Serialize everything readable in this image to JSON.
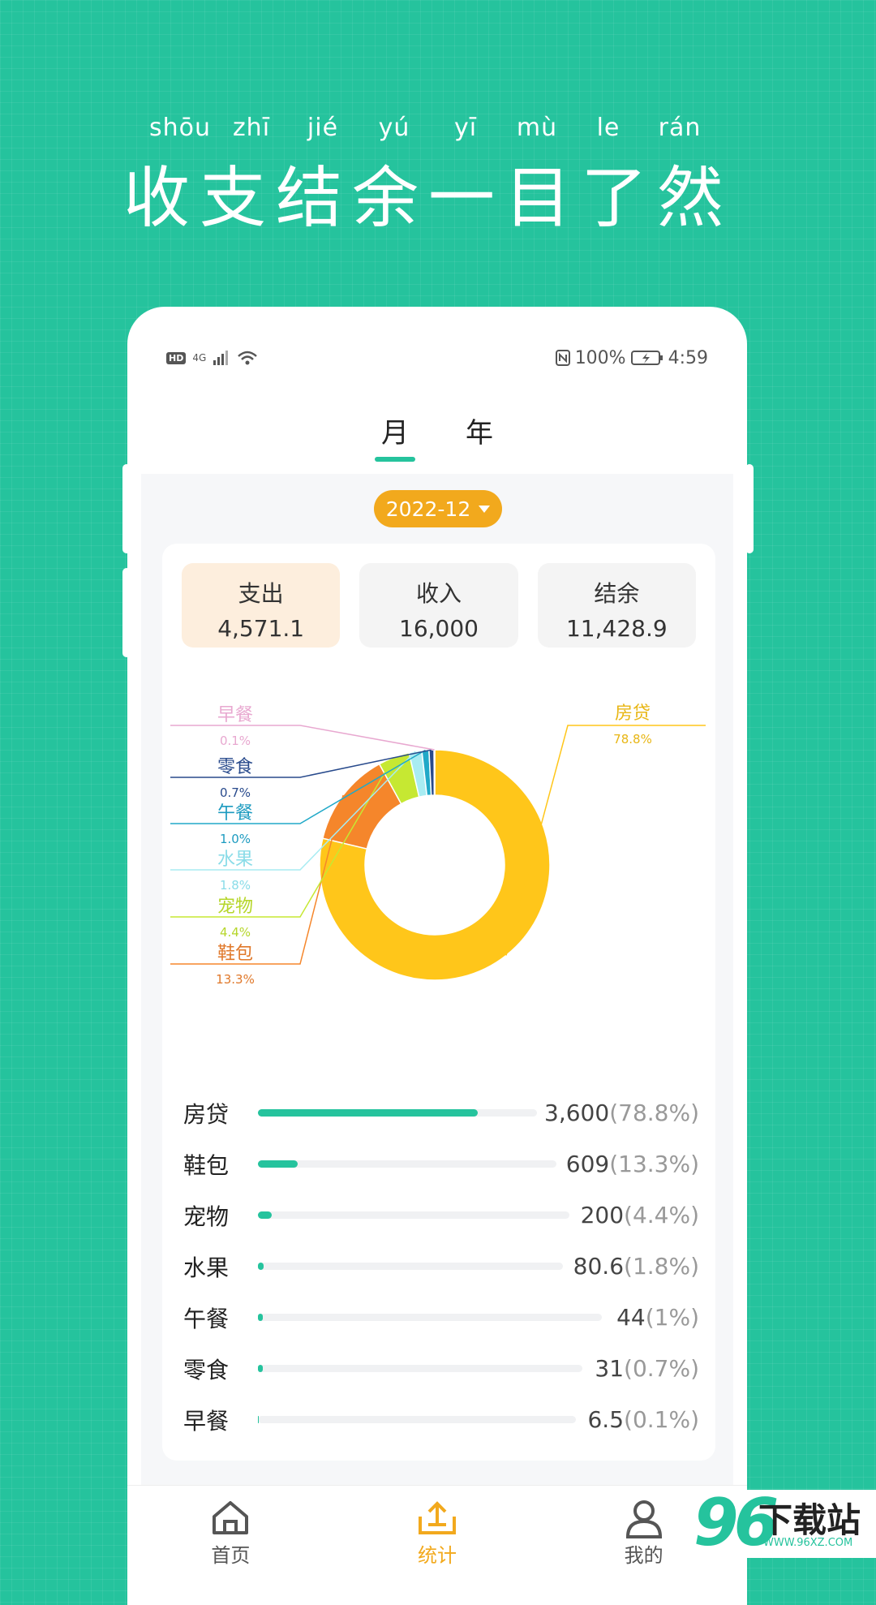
{
  "hero": {
    "pinyin": [
      "shōu",
      "zhī",
      "jié",
      "yú",
      "yī",
      "mù",
      "le",
      "rán"
    ],
    "title": "收支结余一目了然"
  },
  "status_bar": {
    "left": "4G",
    "battery": "100%",
    "time": "4:59",
    "hd": "HD"
  },
  "tabs": [
    {
      "label": "月",
      "active": true
    },
    {
      "label": "年",
      "active": false
    }
  ],
  "date_selector": {
    "value": "2022-12"
  },
  "summary": [
    {
      "label": "支出",
      "value": "4,571.1",
      "active": true
    },
    {
      "label": "收入",
      "value": "16,000",
      "active": false
    },
    {
      "label": "结余",
      "value": "11,428.9",
      "active": false
    }
  ],
  "chart_data": {
    "type": "pie",
    "categories": [
      "房贷",
      "鞋包",
      "宠物",
      "水果",
      "午餐",
      "零食",
      "早餐"
    ],
    "values": [
      78.8,
      13.3,
      4.4,
      1.8,
      1.0,
      0.7,
      0.1
    ],
    "labels": [
      "78.8%",
      "13.3%",
      "4.4%",
      "1.8%",
      "1.0%",
      "0.7%",
      "0.1%"
    ],
    "colors": [
      "#ffc61a",
      "#f5862b",
      "#c6e832",
      "#a8ecf2",
      "#20a9c8",
      "#284a8c",
      "#e8a8d0"
    ]
  },
  "breakdown": [
    {
      "name": "房贷",
      "amount": "3,600",
      "pct": "(78.8%)",
      "fraction": 0.788
    },
    {
      "name": "鞋包",
      "amount": "609",
      "pct": "(13.3%)",
      "fraction": 0.133
    },
    {
      "name": "宠物",
      "amount": "200",
      "pct": "(4.4%)",
      "fraction": 0.044
    },
    {
      "name": "水果",
      "amount": "80.6",
      "pct": "(1.8%)",
      "fraction": 0.018
    },
    {
      "name": "午餐",
      "amount": "44",
      "pct": "(1%)",
      "fraction": 0.01
    },
    {
      "name": "零食",
      "amount": "31",
      "pct": "(0.7%)",
      "fraction": 0.007
    },
    {
      "name": "早餐",
      "amount": "6.5",
      "pct": "(0.1%)",
      "fraction": 0.001
    }
  ],
  "nav": [
    {
      "label": "首页",
      "icon": "home-icon",
      "active": false
    },
    {
      "label": "统计",
      "icon": "stats-icon",
      "active": true
    },
    {
      "label": "我的",
      "icon": "profile-icon",
      "active": false
    }
  ],
  "watermark": {
    "num": "96",
    "text": "下载站",
    "url": "WWW.96XZ.COM"
  }
}
